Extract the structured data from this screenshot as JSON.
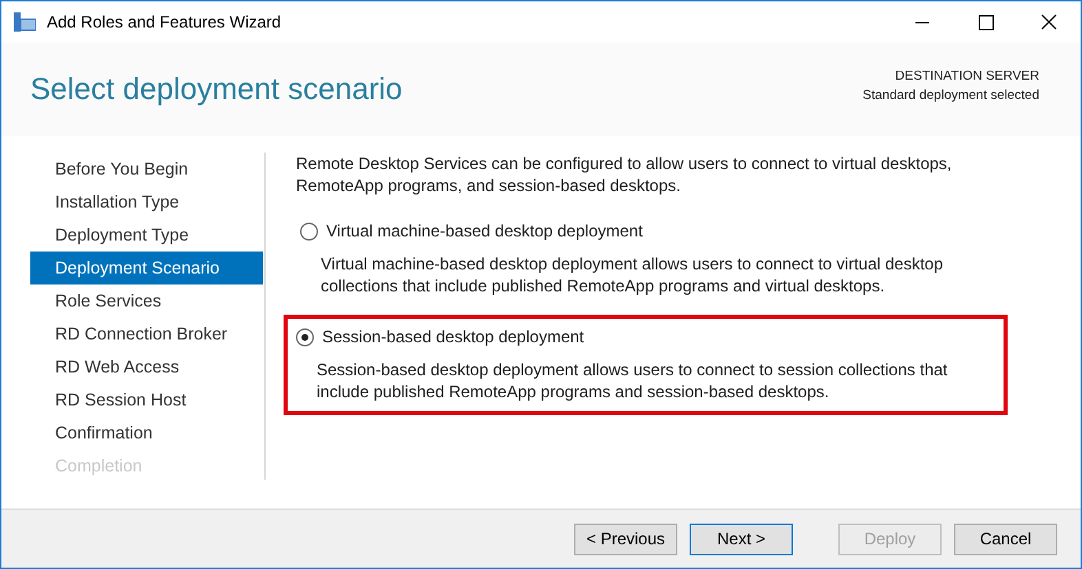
{
  "window": {
    "title": "Add Roles and Features Wizard"
  },
  "header": {
    "title": "Select deployment scenario",
    "server_label": "DESTINATION SERVER",
    "server_value": "Standard deployment selected"
  },
  "sidebar": {
    "items": [
      {
        "label": "Before You Begin",
        "selected": false,
        "disabled": false
      },
      {
        "label": "Installation Type",
        "selected": false,
        "disabled": false
      },
      {
        "label": "Deployment Type",
        "selected": false,
        "disabled": false
      },
      {
        "label": "Deployment Scenario",
        "selected": true,
        "disabled": false
      },
      {
        "label": "Role Services",
        "selected": false,
        "disabled": false
      },
      {
        "label": "RD Connection Broker",
        "selected": false,
        "disabled": false
      },
      {
        "label": "RD Web Access",
        "selected": false,
        "disabled": false
      },
      {
        "label": "RD Session Host",
        "selected": false,
        "disabled": false
      },
      {
        "label": "Confirmation",
        "selected": false,
        "disabled": false
      },
      {
        "label": "Completion",
        "selected": false,
        "disabled": true
      }
    ]
  },
  "intro": "Remote Desktop Services can be configured to allow users to connect to virtual desktops, RemoteApp programs, and session-based desktops.",
  "options": [
    {
      "label": "Virtual machine-based desktop deployment",
      "description": "Virtual machine-based desktop deployment allows users to connect to virtual desktop collections that include published RemoteApp programs and virtual desktops.",
      "selected": false,
      "highlighted": false
    },
    {
      "label": "Session-based desktop deployment",
      "description": "Session-based desktop deployment allows users to connect to session collections that include published RemoteApp programs and session-based desktops.",
      "selected": true,
      "highlighted": true
    }
  ],
  "buttons": [
    {
      "label": "< Previous",
      "default": false,
      "disabled": false
    },
    {
      "label": "Next >",
      "default": true,
      "disabled": false
    },
    {
      "label": "Deploy",
      "default": false,
      "disabled": true
    },
    {
      "label": "Cancel",
      "default": false,
      "disabled": false
    }
  ]
}
